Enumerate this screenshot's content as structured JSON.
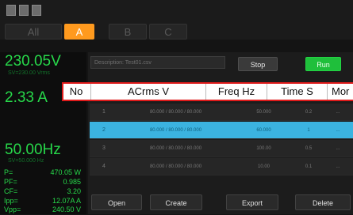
{
  "tabs": [
    {
      "label": "All",
      "active": false
    },
    {
      "label": "A",
      "active": true
    },
    {
      "label": "B",
      "active": false
    },
    {
      "label": "C",
      "active": false
    }
  ],
  "toolbar_icons": [
    "usb-icon",
    "lan-icon",
    "keyboard-icon"
  ],
  "readings": {
    "voltage": {
      "value": "230.05V",
      "sub": "SV=230.00 Vrms"
    },
    "current": {
      "value": "2.33 A"
    },
    "frequency": {
      "value": "50.00Hz",
      "sub": "SV=50.000 Hz"
    },
    "list": [
      {
        "label": "P=",
        "value": "470.05 W"
      },
      {
        "label": "PF=",
        "value": "0.985"
      },
      {
        "label": "CF=",
        "value": "3.20"
      },
      {
        "label": "Ipp=",
        "value": "12.07A A"
      },
      {
        "label": "Vpp=",
        "value": "240.50 V"
      }
    ]
  },
  "description": {
    "label": "Description:",
    "value": "Test01.csv"
  },
  "buttons": {
    "stop": "Stop",
    "run": "Run"
  },
  "table": {
    "headers": [
      "No",
      "ACrms V",
      "Freq Hz",
      "Time S",
      "Mor"
    ],
    "rows": [
      {
        "no": "1",
        "acrms": "80.000 / 80.000 / 80.000",
        "freq": "50.000",
        "time": "0.2",
        "more": "...",
        "selected": false
      },
      {
        "no": "2",
        "acrms": "80.000 / 80.000 / 80.000",
        "freq": "60.000",
        "time": "1",
        "more": "...",
        "selected": true
      },
      {
        "no": "3",
        "acrms": "80.000 / 80.000 / 80.000",
        "freq": "100.00",
        "time": "0.5",
        "more": "...",
        "selected": false
      },
      {
        "no": "4",
        "acrms": "80.000 / 80.000 / 80.000",
        "freq": "10.00",
        "time": "0.1",
        "more": "...",
        "selected": false
      }
    ]
  },
  "bottom_buttons": [
    "Open",
    "Create",
    "Export",
    "Delete"
  ],
  "colors": {
    "accent_orange": "#ff9a1e",
    "reading_green": "#27d84a",
    "run_green": "#1fbf3b",
    "selected_row": "#3bb3e0",
    "highlight_red": "#e01b1b"
  }
}
